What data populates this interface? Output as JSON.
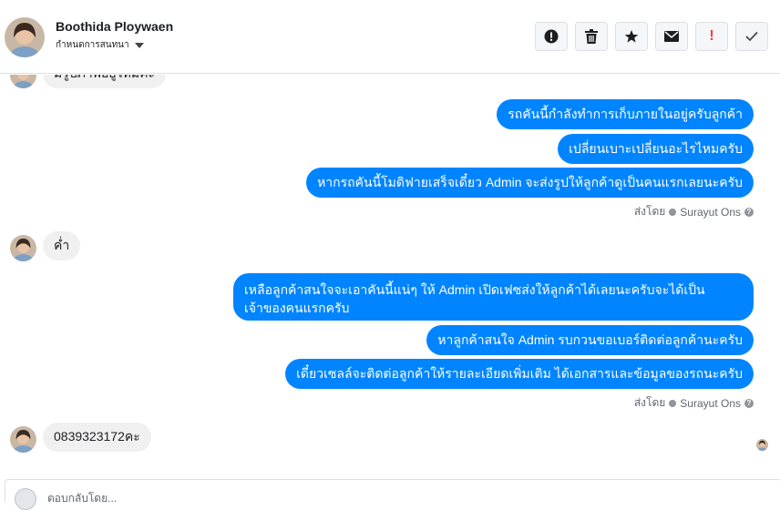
{
  "header": {
    "contact_name": "Boothida Ploywaen",
    "subtitle": "กำหนดการสนทนา",
    "actions": [
      {
        "icon": "alert-circle-icon"
      },
      {
        "icon": "trash-icon"
      },
      {
        "icon": "star-icon"
      },
      {
        "icon": "mail-icon"
      },
      {
        "icon": "exclamation-icon",
        "label": "!"
      },
      {
        "icon": "check-icon"
      }
    ]
  },
  "chat": {
    "partial_top_message": "มีรูปภาพอยู่ไหมคะ",
    "group1": {
      "messages": [
        "รถคันนี้กำลังทำการเก็บภายในอยู่ครับลูกค้า",
        "เปลี่ยนเบาะเปลี่ยนอะไรไหมครับ",
        "หากรถคันนี้โมดิฟายเสร็จเดี๋ยว Admin จะส่งรูปให้ลูกค้าดูเป็นคนแรกเลยนะครับ"
      ],
      "sent_by_label": "ส่งโดย",
      "sent_by_name": "Surayut Ons"
    },
    "incoming1": "ค่ำ",
    "group2": {
      "messages": [
        "เหลือลูกค้าสนใจจะเอาคันนี้แน่ๆ ให้ Admin เปิดเฟซส่งให้ลูกค้าได้เลยนะครับจะได้เป็นเจ้าของคนแรกครับ",
        "หาลูกค้าสนใจ Admin รบกวนขอเบอร์ติดต่อลูกค้านะครับ",
        "เดี๋ยวเซลล์จะติดต่อลูกค้าให้รายละเอียดเพิ่มเติม ได้เอกสารและข้อมูลของรถนะครับ"
      ],
      "sent_by_label": "ส่งโดย",
      "sent_by_name": "Surayut Ons"
    },
    "incoming2": "0839323172คะ"
  },
  "composer": {
    "placeholder": "ตอบกลับโดย..."
  },
  "colors": {
    "accent": "#0084ff",
    "incoming_bubble": "#f1f0f0",
    "danger": "#fa383e"
  }
}
